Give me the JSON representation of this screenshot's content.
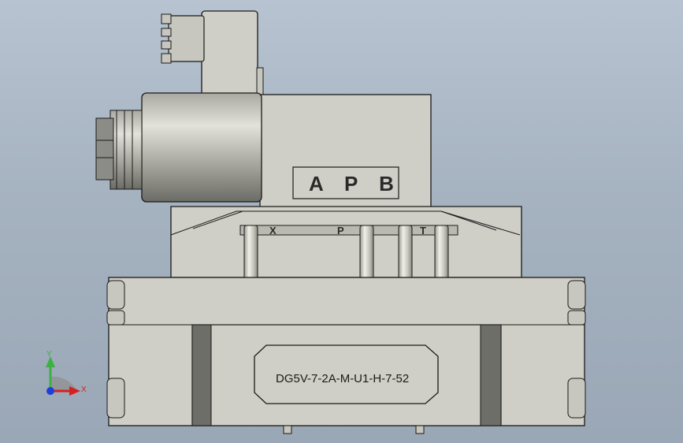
{
  "viewport": {
    "background_top": "#b7c3d0",
    "background_bottom": "#9aa7b6"
  },
  "model": {
    "part_label": "DG5V-7-2A-M-U1-H-7-52",
    "brand_plate": "A P B",
    "port_labels": [
      "X",
      "P",
      "T"
    ],
    "body_color": "#cfcfc7",
    "edge_color": "#1a1a1a",
    "dark_band_color": "#6e6e68"
  },
  "triad": {
    "y_label": "Y",
    "x_label": "X",
    "y_color": "#3cb043",
    "x_color": "#d62020",
    "z_color": "#1f3fd6"
  }
}
